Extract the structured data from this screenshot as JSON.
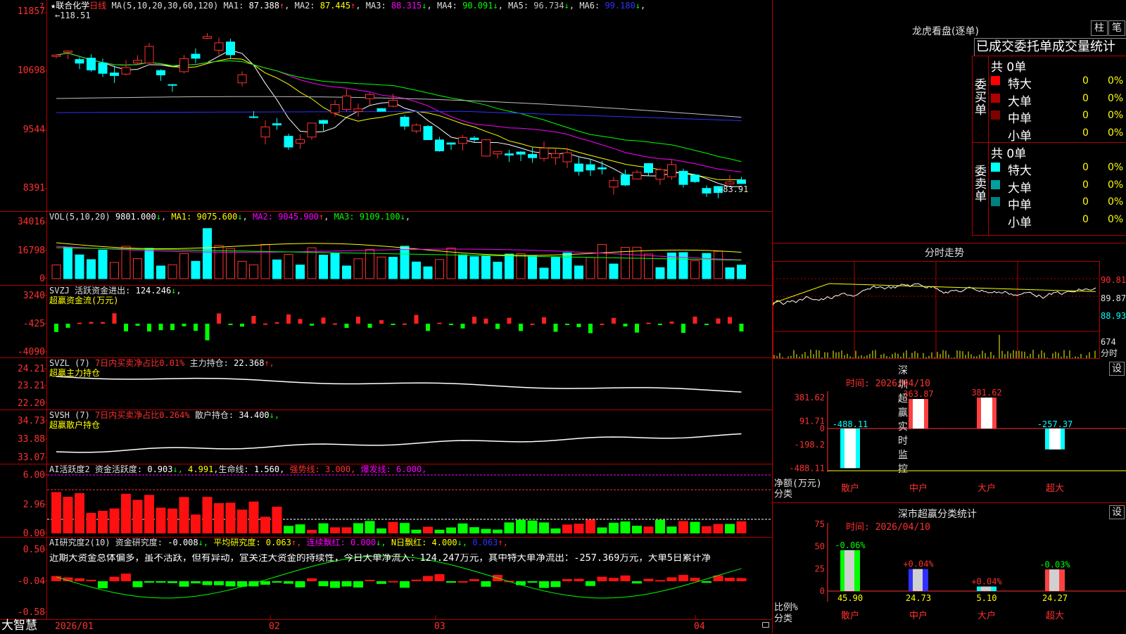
{
  "app": {
    "brand": "大智慧",
    "lock_icon": "lock-icon"
  },
  "main_chart": {
    "header": {
      "star": "★",
      "stock": "联合化学",
      "period": "日线",
      "ma_spec": "MA(5,10,20,30,60,120)",
      "ma": [
        {
          "name": "MA1:",
          "value": "87.388",
          "arrow": "↑",
          "color": "#ffffff"
        },
        {
          "name": "MA2:",
          "value": "87.445",
          "arrow": "↑",
          "color": "#ffff00"
        },
        {
          "name": "MA3:",
          "value": "88.315",
          "arrow": "↓",
          "color": "#ff00ff"
        },
        {
          "name": "MA4:",
          "value": "90.091",
          "arrow": "↓",
          "color": "#00ff00"
        },
        {
          "name": "MA5:",
          "value": "96.734",
          "arrow": "↓",
          "color": "#c0c0c0"
        },
        {
          "name": "MA6:",
          "value": "99.180",
          "arrow": "↓",
          "color": "#3030ff"
        }
      ]
    },
    "y_labels": [
      "11857",
      "10698",
      "9544",
      "8391"
    ],
    "high_mark": "118.51",
    "low_mark": "83.91",
    "x_labels": [
      "2026/01",
      "02",
      "03",
      "04"
    ]
  },
  "vol": {
    "spec": "VOL(5,10,20)",
    "value": "9801.000",
    "value_arrow": "↓",
    "ma": [
      {
        "name": "MA1:",
        "value": "9075.600",
        "arrow": "↓",
        "color": "#ffff00"
      },
      {
        "name": "MA2:",
        "value": "9045.900",
        "arrow": "↑",
        "color": "#ff00ff"
      },
      {
        "name": "MA3:",
        "value": "9109.100",
        "arrow": "↓",
        "color": "#00ff00"
      }
    ],
    "y_labels": [
      "34016",
      "16798",
      "0"
    ]
  },
  "svzj": {
    "label": "SVZJ  活跃资金进出:",
    "value": "124.246",
    "arrow": "↓",
    "subtitle": "超赢资金流(万元)",
    "y_labels": [
      "3240",
      "-425",
      "-4090"
    ]
  },
  "svzl": {
    "label": "SVZL (7)",
    "ratio_text": "7日内买卖净占比0.01%",
    "hold_label": "主力持仓:",
    "hold_value": "22.368",
    "arrow": "↑,",
    "subtitle": "超赢主力持仓",
    "y_labels": [
      "24.21",
      "23.21",
      "22.20"
    ]
  },
  "svsh": {
    "label": "SVSH (7)",
    "ratio_text": "7日内买卖净占比0.264%",
    "hold_label": "散户持仓:",
    "hold_value": "34.400",
    "arrow": "↓,",
    "subtitle": "超赢散户持仓",
    "y_labels": [
      "34.73",
      "33.88",
      "33.07"
    ]
  },
  "ai_active": {
    "label": "AI活跃度2 资金活跃度:",
    "v1": "0.903",
    "a1": "↓,",
    "v2": "4.991",
    "life_label": ",生命线:",
    "life": "1.560",
    "strong": "强势线: 3.000,",
    "burst": "爆发线: 6.000,",
    "y_labels": [
      "6.00",
      "2.96",
      "0.00"
    ]
  },
  "ai_research": {
    "label": "AI研究度2(10) 资金研究度:",
    "v1": "-0.008",
    "a1": "↓,",
    "avg": "平均研究度: 0.063",
    "a2": "↑,",
    "streak": "连续飘红: 0.000",
    "a3": "↓,",
    "nday": "N日飘红: 4.000",
    "a4": "↓,",
    "v5": "0.063",
    "a5": "↑,",
    "comment": "近期大资金总体偏多，虽不活跃，但有异动，宜关注大资金的持续性，今日大单净流入：124.247万元，其中特大单净流出：-257.369万元，大单5日累计净",
    "y_labels": [
      "0.50",
      "-0.04",
      "-0.58"
    ]
  },
  "dragon_tiger": {
    "title": "龙虎看盘(逐单)",
    "btn_bar": "柱",
    "btn_pen": "笔",
    "tabs": [
      "已成交",
      "委托单",
      "成交量统计"
    ],
    "buy": {
      "side_label": "委买单",
      "total": "共 0单",
      "rows": [
        {
          "label": "特大",
          "count": "0",
          "pct": "0%",
          "color": "#ff0000"
        },
        {
          "label": "大单",
          "count": "0",
          "pct": "0%",
          "color": "#b00000"
        },
        {
          "label": "中单",
          "count": "0",
          "pct": "0%",
          "color": "#800000"
        },
        {
          "label": "小单",
          "count": "0",
          "pct": "0%",
          "color": ""
        }
      ]
    },
    "sell": {
      "side_label": "委卖单",
      "total": "共 0单",
      "rows": [
        {
          "label": "特大",
          "count": "0",
          "pct": "0%",
          "color": "#00ffff"
        },
        {
          "label": "大单",
          "count": "0",
          "pct": "0%",
          "color": "#00a0a0"
        },
        {
          "label": "中单",
          "count": "0",
          "pct": "0%",
          "color": "#008080"
        },
        {
          "label": "小单",
          "count": "0",
          "pct": "0%",
          "color": ""
        }
      ]
    }
  },
  "intraday": {
    "title": "分时走势",
    "labels": [
      "90.81",
      "89.87",
      "88.93"
    ],
    "vol_label": "674",
    "unit": "分时"
  },
  "sz_monitor": {
    "title": "深圳超赢实时监控",
    "btn": "设",
    "time": "时间: 2026/04/10",
    "y_labels": [
      "381.62",
      "91.71",
      "0",
      "-198.2",
      "-488.11"
    ],
    "unit_top": "净额(万元)",
    "unit_bottom": "分类",
    "bars": [
      {
        "category": "散户",
        "value": -488.11,
        "label": "-488.11"
      },
      {
        "category": "中户",
        "value": 363.87,
        "label": "363.87"
      },
      {
        "category": "大户",
        "value": 381.62,
        "label": "381.62"
      },
      {
        "category": "超大",
        "value": -257.37,
        "label": "-257.37"
      }
    ]
  },
  "sz_classify": {
    "title": "深市超赢分类统计",
    "btn": "设",
    "time": "时间: 2026/04/10",
    "y_labels": [
      "75",
      "50",
      "25",
      "0"
    ],
    "unit_top": "比例%",
    "unit_bottom": "分类",
    "bars": [
      {
        "category": "散户",
        "value": 45.9,
        "label": "45.90",
        "change": "-0.06%",
        "change_color": "#00ff00"
      },
      {
        "category": "中户",
        "value": 24.73,
        "label": "24.73",
        "change": "+0.04%",
        "change_color": "#ff3030"
      },
      {
        "category": "大户",
        "value": 5.1,
        "label": "5.10",
        "change": "+0.04%",
        "change_color": "#ff3030"
      },
      {
        "category": "超大",
        "value": 24.27,
        "label": "24.27",
        "change": "-0.03%",
        "change_color": "#00ff00"
      }
    ]
  }
}
